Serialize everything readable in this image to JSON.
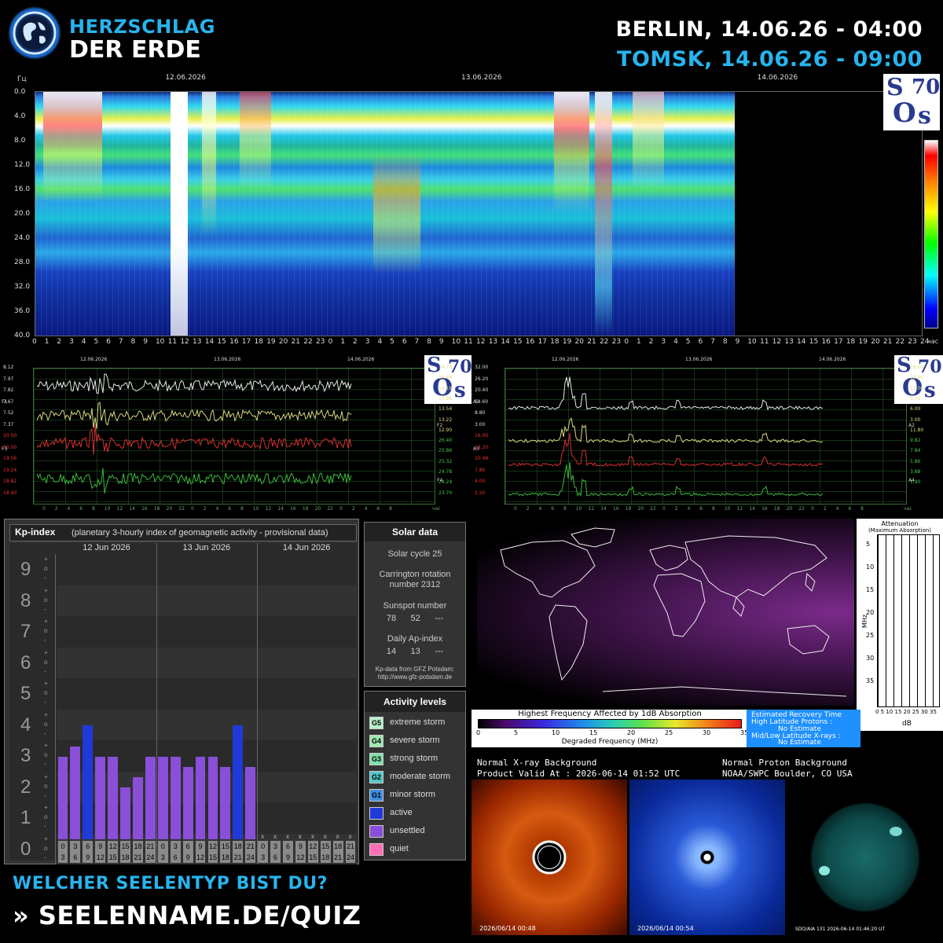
{
  "brand": {
    "line1": "HERZSCHLAG",
    "line2": "DER ERDE"
  },
  "times": {
    "city1": "BERLIN, 14.06.26 - 04:00",
    "city2": "TOMSK, 14.06.26 - 09:00"
  },
  "colors": {
    "accent": "#27b4ee",
    "active": "#1f3ad8",
    "unsettled": "#8a4fd8",
    "quiet": "#ff6fb4"
  },
  "spectrogram": {
    "y_unit": "Гц",
    "y_ticks": [
      "0.0",
      "4.0",
      "8.0",
      "12.0",
      "16.0",
      "20.0",
      "24.0",
      "28.0",
      "32.0",
      "36.0",
      "40.0"
    ],
    "dates": [
      "12.06.2026",
      "13.06.2026",
      "14.06.2026"
    ],
    "x_ticks": [
      "0",
      "1",
      "2",
      "3",
      "4",
      "5",
      "6",
      "7",
      "8",
      "9",
      "10",
      "11",
      "12",
      "13",
      "14",
      "15",
      "16",
      "17",
      "18",
      "19",
      "20",
      "21",
      "22",
      "23",
      "0",
      "1",
      "2",
      "3",
      "4",
      "5",
      "6",
      "7",
      "8",
      "9",
      "10",
      "11",
      "12",
      "13",
      "14",
      "15",
      "16",
      "17",
      "18",
      "19",
      "20",
      "21",
      "22",
      "23",
      "0",
      "1",
      "2",
      "3",
      "4",
      "5",
      "6",
      "7",
      "8",
      "9",
      "10",
      "11",
      "12",
      "13",
      "14",
      "15",
      "16",
      "17",
      "18",
      "19",
      "20",
      "21",
      "22",
      "23",
      "24"
    ],
    "x_unit": "час"
  },
  "sos_logo": {
    "s1": "S",
    "o": "O",
    "s2": "s",
    "num": "70"
  },
  "freq_chart": {
    "dates": [
      "12.06.2026",
      "13.06.2026",
      "14.06.2026"
    ],
    "left_labels": [
      "8.12",
      "7.97",
      "7.82",
      "7.67",
      "7.52",
      "7.37",
      "20.50",
      "20.00",
      "19.56",
      "19.24",
      "18.82",
      "18.40"
    ],
    "right_labels": [
      "14.78",
      "14.48",
      "14.18",
      "13.86",
      "13.54",
      "13.22",
      "12.90",
      "26.40",
      "25.86",
      "25.32",
      "24.78",
      "24.24",
      "23.70"
    ],
    "series_codes": [
      "F1",
      "F2",
      "F3",
      "F4"
    ],
    "x_ticks": [
      "0",
      "2",
      "4",
      "6",
      "8",
      "10",
      "12",
      "14",
      "16",
      "18",
      "20",
      "22",
      "0",
      "2",
      "4",
      "6",
      "8",
      "10",
      "12",
      "14",
      "16",
      "18",
      "20",
      "22",
      "0",
      "2",
      "4",
      "6",
      "8"
    ],
    "x_unit": "час"
  },
  "amp_chart": {
    "dates": [
      "12.06.2026",
      "13.06.2026",
      "14.06.2026"
    ],
    "left_labels": [
      "32.00",
      "26.20",
      "20.40",
      "14.60",
      "8.80",
      "3.00",
      "16.00",
      "13.20",
      "10.48",
      "7.80",
      "4.00",
      "2.20"
    ],
    "right_labels": [
      "18.00",
      "15.00",
      "12.00",
      "9.00",
      "6.00",
      "3.00",
      "11.80",
      "9.82",
      "7.84",
      "5.86",
      "3.88",
      "1.90"
    ],
    "series_codes": [
      "A1",
      "A2",
      "A3",
      "A4"
    ],
    "x_ticks": [
      "0",
      "2",
      "4",
      "6",
      "8",
      "10",
      "12",
      "14",
      "16",
      "18",
      "20",
      "22",
      "0",
      "2",
      "4",
      "6",
      "8",
      "10",
      "12",
      "14",
      "16",
      "18",
      "20",
      "22",
      "0",
      "2",
      "4",
      "6",
      "8"
    ],
    "x_unit": "час"
  },
  "kp": {
    "title": "Kp-index",
    "subtitle": "(planetary 3-hourly index of geomagnetic activity - provisional data)",
    "levels": [
      "9",
      "8",
      "7",
      "6",
      "5",
      "4",
      "3",
      "2",
      "1",
      "0"
    ],
    "sub_marks": [
      "+",
      "o",
      "-"
    ],
    "days": [
      "12 Jun 2026",
      "13 Jun 2026",
      "14 Jun 2026"
    ],
    "hours_top": [
      "0",
      "3",
      "6",
      "9",
      "12",
      "15",
      "18",
      "21"
    ],
    "hours_bottom": [
      "3",
      "6",
      "9",
      "12",
      "15",
      "18",
      "21",
      "24"
    ],
    "missing_mark": "x",
    "values": [
      2.67,
      3.0,
      3.67,
      2.67,
      2.67,
      1.67,
      2.0,
      2.67,
      2.67,
      2.67,
      2.33,
      2.67,
      2.67,
      2.33,
      3.67,
      2.33
    ],
    "active": [
      false,
      false,
      true,
      false,
      false,
      false,
      false,
      false,
      false,
      false,
      false,
      false,
      false,
      false,
      true,
      false
    ]
  },
  "solar": {
    "title": "Solar data",
    "cycle": "Solar cycle 25",
    "carrington_1": "Carrington rotation",
    "carrington_2": "number 2312",
    "sunspot_label": "Sunspot number",
    "sunspot_values": "78      52      ---",
    "ap_label": "Daily Ap-index",
    "ap_values": "14      13      ---",
    "credit_1": "Kp-data from GFZ Potsdam:",
    "credit_2": "http://www.gfz-potsdam.de"
  },
  "activity": {
    "title": "Activity levels",
    "items": [
      {
        "code": "G5",
        "label": "extreme storm",
        "color": "#b8f0c8"
      },
      {
        "code": "G4",
        "label": "severe storm",
        "color": "#9ee8b0"
      },
      {
        "code": "G3",
        "label": "strong storm",
        "color": "#7fe0a8"
      },
      {
        "code": "G2",
        "label": "moderate storm",
        "color": "#52c8c8"
      },
      {
        "code": "G1",
        "label": "minor storm",
        "color": "#3a8ee0"
      },
      {
        "code": "",
        "label": "active",
        "color": "#1f3ad8"
      },
      {
        "code": "",
        "label": "unsettled",
        "color": "#8a4fd8"
      },
      {
        "code": "",
        "label": "quiet",
        "color": "#ff6fb4"
      }
    ]
  },
  "drap": {
    "atten_title_1": "Attenuation",
    "atten_title_2": "(Maximum Absorption)",
    "atten_yticks": [
      "5",
      "10",
      "15",
      "20",
      "25",
      "30",
      "35"
    ],
    "atten_xticks": "0 5 10 15 20 25 30 35",
    "atten_ylabel": "MHz",
    "atten_xlabel": "dB",
    "scale_title": "Highest Frequency Affected by 1dB Absorption",
    "scale_ticks": [
      "0",
      "5",
      "10",
      "15",
      "20",
      "25",
      "30",
      "35"
    ],
    "scale_label": "Degraded Frequency (MHz)",
    "recovery_title": "Estimated Recovery Time",
    "recovery_high": "High Latitude Protons :",
    "recovery_high_val": "No Estimate",
    "recovery_mid": "Mid/Low Latitude X-rays :",
    "recovery_mid_val": "No Estimate",
    "xray": "Normal X-ray Background",
    "valid": "Product Valid At : 2026-06-14 01:52 UTC",
    "proton": "Normal Proton Background",
    "noaa": "NOAA/SWPC Boulder, CO USA"
  },
  "images": {
    "lasco_c2_ts": "2026/06/14 00:48",
    "lasco_c3_ts": "2026/06/14 00:54",
    "sdo_ts": "SDO/AIA 131   2026-06-14 01:46:20 UT"
  },
  "footer": {
    "question": "WELCHER SEELENTYP BIST DU?",
    "url": "» SEELENNAME.DE/QUIZ"
  }
}
